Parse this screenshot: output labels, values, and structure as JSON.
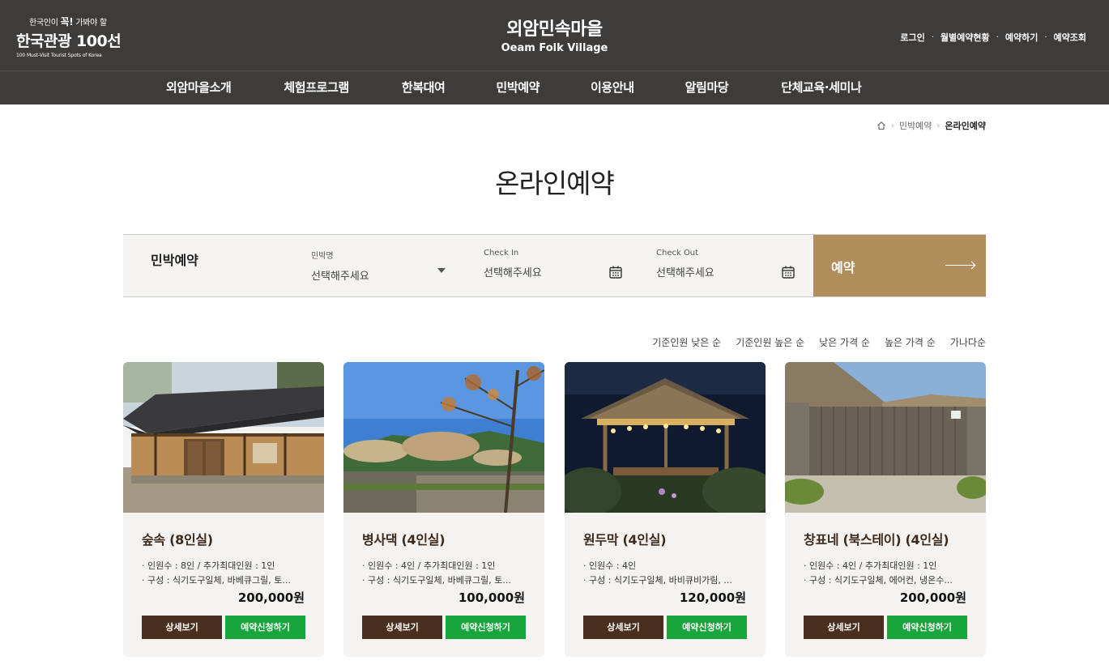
{
  "header": {
    "logo": {
      "line1_a": "한국인이",
      "line1_b": "꼭!",
      "line1_c": "가봐야 할",
      "line2": "한국관광 100선",
      "line3": "100 Must-Visit Tourist Spots of Korea"
    },
    "title_ko": "외암민속마을",
    "title_en": "Oeam Folk Village",
    "util": [
      "로그인",
      "월별예약현황",
      "예약하기",
      "예약조회"
    ]
  },
  "nav": [
    "외암마을소개",
    "체험프로그램",
    "한복대여",
    "민박예약",
    "이용안내",
    "알림마당",
    "단체교육·세미나"
  ],
  "breadcrumb": {
    "section": "민박예약",
    "current": "온라인예약"
  },
  "page_title": "온라인예약",
  "search": {
    "label": "민박예약",
    "house_caption": "민박명",
    "house_placeholder": "선택해주세요",
    "checkin_caption": "Check In",
    "checkin_placeholder": "선택해주세요",
    "checkout_caption": "Check Out",
    "checkout_placeholder": "선택해주세요",
    "button": "예약"
  },
  "sort_options": [
    "기준인원 낮은 순",
    "기준인원 높은 순",
    "낮은 가격 순",
    "높은 가격 순",
    "가나다순"
  ],
  "cards": [
    {
      "name": "숲속 (8인실)",
      "capacity": "· 인원수 : 8인 / 추가최대인원 : 1인",
      "config": "· 구성 : 식기도구일체, 바베큐그릴, 토...",
      "price": "200,000원",
      "detail": "상세보기",
      "apply": "예약신청하기"
    },
    {
      "name": "병사댁 (4인실)",
      "capacity": "· 인원수 : 4인 / 추가최대인원 : 1인",
      "config": "· 구성 : 식기도구일체, 바베큐그릴, 토...",
      "price": "100,000원",
      "detail": "상세보기",
      "apply": "예약신청하기"
    },
    {
      "name": "원두막 (4인실)",
      "capacity": "· 인원수 : 4인",
      "config": "· 구성 : 식기도구일체, 바비큐비가림, ...",
      "price": "120,000원",
      "detail": "상세보기",
      "apply": "예약신청하기"
    },
    {
      "name": "창표네 (북스테이) (4인실)",
      "capacity": "· 인원수 : 4인 / 추가최대인원 : 1인",
      "config": "· 구성 : 식기도구일체, 에어컨, 냉온수...",
      "price": "200,000원",
      "detail": "상세보기",
      "apply": "예약신청하기"
    }
  ],
  "colors": {
    "header_bg": "#3e3c3b",
    "book_button": "#b08e5c",
    "detail_button": "#4a2f1e",
    "apply_button": "#17a53c"
  }
}
